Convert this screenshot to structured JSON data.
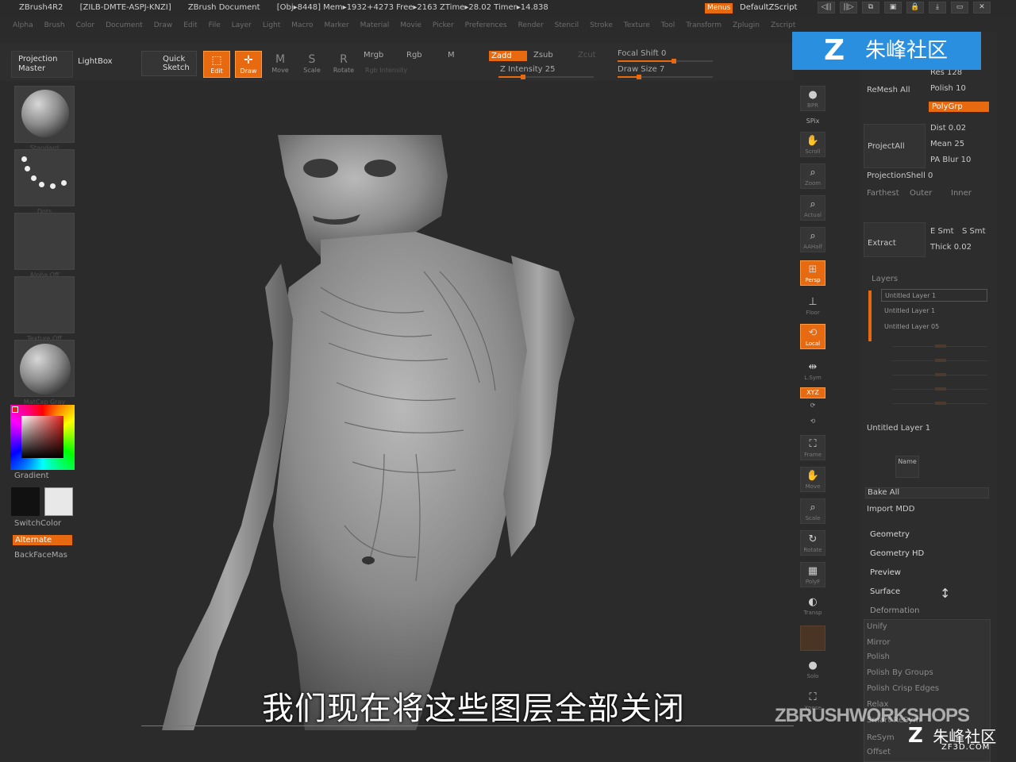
{
  "titlebar": {
    "app": "ZBrush4R2",
    "serial": "[ZILB-DMTE-ASPJ-KNZI]",
    "document": "ZBrush Document",
    "stats": "[Obj▸8448] Mem▸1932+4273 Free▸2163 ZTime▸28.02 Timer▸14.838",
    "menus": "Menus",
    "script": "DefaultZScript",
    "icons": [
      "◁||",
      "||▷",
      "⧉",
      "▣",
      "🔒",
      "⤓",
      "▭",
      "✕"
    ]
  },
  "menubar": [
    "Alpha",
    "Brush",
    "Color",
    "Document",
    "Draw",
    "Edit",
    "File",
    "Layer",
    "Light",
    "Macro",
    "Marker",
    "Material",
    "Movie",
    "Picker",
    "Preferences",
    "Render",
    "Stencil",
    "Stroke",
    "Texture",
    "Tool",
    "Transform",
    "Zplugin",
    "Zscript"
  ],
  "shelf": {
    "projection_master": "Projection Master",
    "lightbox": "LightBox",
    "quick_sketch": "Quick Sketch",
    "edit": "Edit",
    "draw": "Draw",
    "move": "Move",
    "scale": "Scale",
    "rotate": "Rotate",
    "mrgb": "Mrgb",
    "rgb": "Rgb",
    "m": "M",
    "zadd": "Zadd",
    "zsub": "Zsub",
    "zcut": "Zcut",
    "z_intensity": "Z Intensity 25",
    "focal_shift": "Focal Shift 0",
    "draw_size": "Draw Size 7",
    "rgb_intensity": "Rgb Intensity"
  },
  "left": {
    "standard": "Standard",
    "dots": "Dots",
    "alpha_off": "Alpha Off",
    "texture_off": "Texture Off",
    "matcap": "MatCap Gray",
    "gradient": "Gradient",
    "switchcolor": "SwitchColor",
    "alternate": "Alternate",
    "backfacemask": "BackFaceMas"
  },
  "rightbar": {
    "bpr": "BPR",
    "spix": "SPix",
    "scroll": "Scroll",
    "zoom": "Zoom",
    "actual": "Actual",
    "aahalf": "AAHalf",
    "persp": "Persp",
    "floor": "Floor",
    "local": "Local",
    "lsym": "L.Sym",
    "xyz": "XYZ",
    "frame": "Frame",
    "move": "Move",
    "scale": "Scale",
    "rotate": "Rotate",
    "polyf": "PolyF",
    "transp": "Transp",
    "solo": "Solo",
    "xpose": "Xpose"
  },
  "tray": {
    "res": "Res 128",
    "remesh_all": "ReMesh All",
    "polish": "Polish 10",
    "polygrp": "PolyGrp",
    "project_all": "ProjectAll",
    "dist": "Dist 0.02",
    "mean": "Mean 25",
    "pa_blur": "PA Blur 10",
    "projection_shell": "ProjectionShell 0",
    "farthest": "Farthest",
    "outer": "Outer",
    "inner": "Inner",
    "extract": "Extract",
    "e_smt": "E Smt",
    "s_smt": "S Smt",
    "thick": "Thick 0.02",
    "layers": "Layers",
    "layer_items": [
      "Untitled Layer 1",
      "Untitled Layer 1",
      "Untitled Layer 05"
    ],
    "current_layer": "Untitled Layer 1",
    "name": "Name",
    "bake_all": "Bake All",
    "import_mdd": "Import MDD",
    "geometry": "Geometry",
    "geometry_hd": "Geometry HD",
    "preview": "Preview",
    "surface": "Surface",
    "deformation": "Deformation",
    "deform_items": [
      "Unify",
      "Mirror",
      "Polish",
      "Polish By Groups",
      "Polish Crisp Edges",
      "Relax",
      "Smart ReSym",
      "ReSym",
      "Offset"
    ]
  },
  "overlays": {
    "logo_text": "朱峰社区",
    "subtitle": "我们现在将这些图层全部关闭",
    "watermark": "ZBRUSHWORKSHOPS",
    "watermark2": "朱峰社区",
    "watermark2_site": "ZF3D.COM"
  },
  "colors": {
    "accent": "#e86a10",
    "panel": "#2d2d2d",
    "logo": "#2b8fe0"
  }
}
